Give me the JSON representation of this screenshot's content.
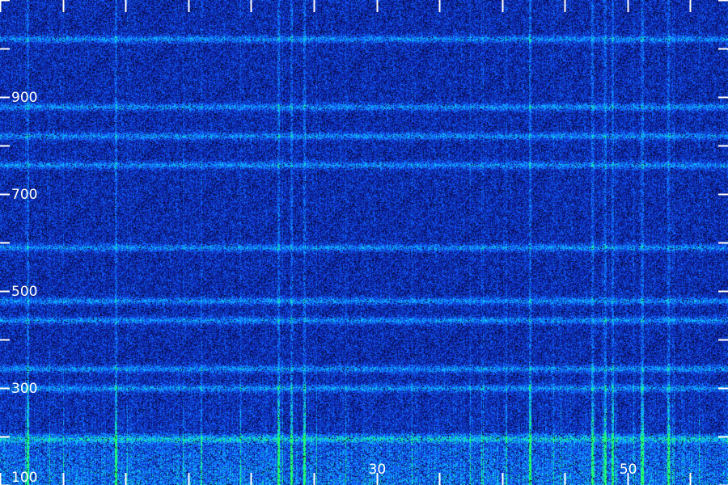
{
  "chart_data": {
    "type": "heatmap",
    "title": "",
    "xlabel": "",
    "ylabel": "",
    "colormap": [
      "#000000",
      "#0a1470",
      "#1030d0",
      "#1070ff",
      "#10c8ff",
      "#20ff70"
    ],
    "x_tick_labels": [
      {
        "value": 30,
        "label": "30"
      },
      {
        "value": 50,
        "label": "50"
      }
    ],
    "y_tick_labels": [
      {
        "value": 900,
        "label": "900"
      },
      {
        "value": 700,
        "label": "700"
      },
      {
        "value": 500,
        "label": "500"
      },
      {
        "value": 300,
        "label": "300"
      },
      {
        "value": 100,
        "label": "100"
      }
    ],
    "xlim": [
      0,
      58
    ],
    "ylim": [
      100,
      1100
    ],
    "horizontal_bands_y": [
      1020,
      880,
      820,
      760,
      590,
      480,
      440,
      340,
      300,
      195
    ],
    "strong_vertical_lines_x": [
      2.2,
      9.2,
      22.2,
      23.2,
      24.2,
      42.2,
      47.2,
      48.2,
      48.8,
      51.2,
      53.2
    ],
    "legend": "none",
    "grid": false
  }
}
